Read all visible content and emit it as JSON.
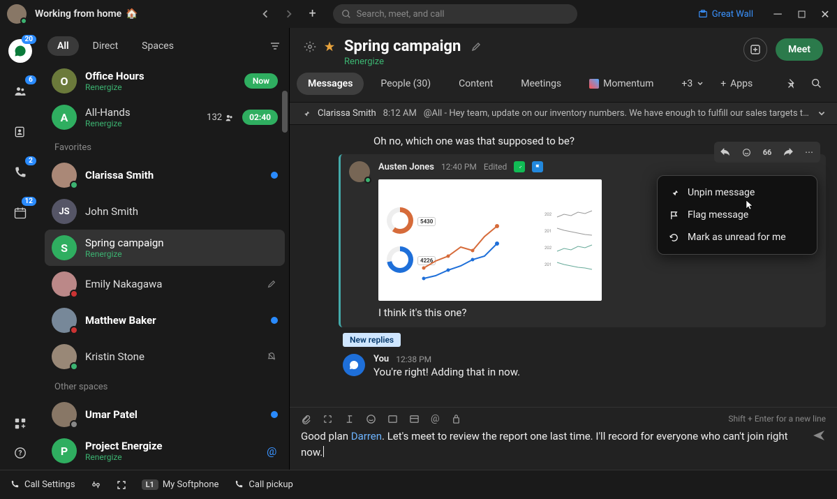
{
  "titlebar": {
    "status": "Working from home",
    "status_emoji": "🏠",
    "search_placeholder": "Search, meet, and call",
    "org_name": "Great Wall"
  },
  "rail": {
    "messaging_badge": "20",
    "teams_badge": "6",
    "calls_badge": "2",
    "calendar_badge": "12"
  },
  "sidebar": {
    "tabs": {
      "all": "All",
      "direct": "Direct",
      "spaces": "Spaces"
    },
    "sections": {
      "favorites": "Favorites",
      "other": "Other spaces"
    },
    "office_hours": {
      "title": "Office Hours",
      "sub": "Renergize",
      "badge": "Now"
    },
    "all_hands": {
      "title": "All-Hands",
      "sub": "Renergize",
      "count": "132",
      "timer": "02:40"
    },
    "clarissa": "Clarissa Smith",
    "john": "John Smith",
    "spring": {
      "title": "Spring campaign",
      "sub": "Renergize"
    },
    "emily": "Emily Nakagawa",
    "matthew": "Matthew Baker",
    "kristin": "Kristin Stone",
    "umar": "Umar Patel",
    "project": {
      "title": "Project Energize",
      "sub": "Renergize"
    }
  },
  "bottombar": {
    "call_settings": "Call Settings",
    "softphone_key": "L1",
    "softphone": "My Softphone",
    "pickup": "Call pickup"
  },
  "space": {
    "name": "Spring campaign",
    "org": "Renergize",
    "meet": "Meet",
    "tabs": {
      "messages": "Messages",
      "people": "People (30)",
      "content": "Content",
      "meetings": "Meetings",
      "momentum": "Momentum",
      "more": "+3",
      "apps": "Apps"
    },
    "pinned": {
      "author": "Clarissa Smith",
      "time": "8:12 AM",
      "text": "@All - Hey team, update on our inventory numbers. We have enough to fulfill our sales targets this mon…"
    }
  },
  "messages": {
    "m1_text": "Oh no, which one was that supposed to be?",
    "austen": {
      "name": "Austen Jones",
      "time": "12:40 PM",
      "edited": "Edited",
      "text": "I think it's this one?"
    },
    "new_replies": "New replies",
    "you": {
      "name": "You",
      "time": "12:38 PM",
      "text": "You're right! Adding that in now."
    }
  },
  "context_menu": {
    "unpin": "Unpin message",
    "flag": "Flag message",
    "unread": "Mark as unread for me"
  },
  "composer": {
    "hint": "Shift + Enter for a new line",
    "text_before": "Good plan ",
    "mention": "Darren",
    "text_after": ". Let's meet to review the report one last time. I'll record for everyone who can't join right now."
  },
  "chart_data": {
    "type": "dashboard-thumbnail",
    "donuts": [
      {
        "label": "5430",
        "percent": 60,
        "color": "#d66b3a"
      },
      {
        "label": "4226",
        "percent": 72,
        "color": "#1e6fd9"
      }
    ],
    "line_series": [
      {
        "name": "orange",
        "values": [
          12,
          18,
          22,
          28,
          26,
          34,
          40
        ],
        "color": "#d66b3a"
      },
      {
        "name": "blue",
        "values": [
          8,
          10,
          14,
          16,
          20,
          22,
          30
        ],
        "color": "#1e6fd9"
      }
    ],
    "sparklines_right": [
      {
        "label": "202",
        "trend": [
          20,
          24,
          22,
          28,
          26,
          30
        ]
      },
      {
        "label": "201",
        "trend": [
          30,
          26,
          24,
          22,
          20,
          18
        ]
      },
      {
        "label": "202",
        "trend": [
          18,
          22,
          20,
          26,
          24,
          28
        ]
      },
      {
        "label": "201",
        "trend": [
          28,
          24,
          22,
          20,
          18,
          16
        ]
      }
    ]
  }
}
